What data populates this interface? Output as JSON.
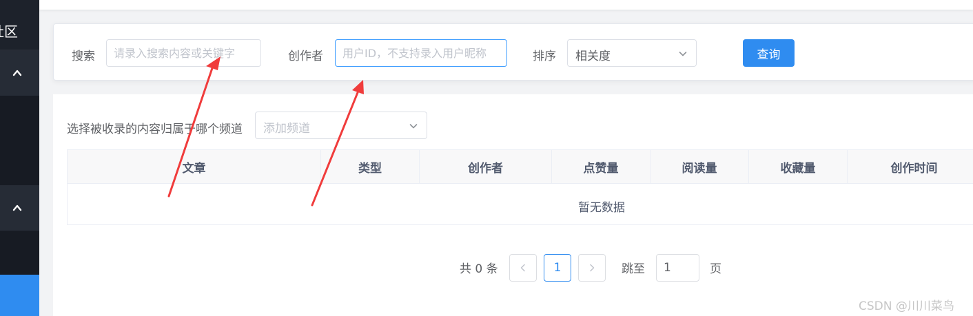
{
  "sidebar": {
    "brand_text": "社区",
    "groups": [
      {
        "icon": "chevron-up-icon"
      },
      {
        "icon": "chevron-up-icon"
      }
    ]
  },
  "search": {
    "keyword_label": "搜索",
    "keyword_placeholder": "请录入搜索内容或关键字",
    "author_label": "创作者",
    "author_placeholder": "用户ID，不支持录入用户昵称",
    "sort_label": "排序",
    "sort_value": "相关度",
    "query_button": "查询"
  },
  "channel": {
    "label": "选择被收录的内容归属于哪个频道",
    "placeholder": "添加频道"
  },
  "table": {
    "columns": [
      "文章",
      "类型",
      "创作者",
      "点赞量",
      "阅读量",
      "收藏量",
      "创作时间"
    ],
    "empty_text": "暂无数据"
  },
  "pagination": {
    "total_text": "共 0 条",
    "current_page": "1",
    "jump_label": "跳至",
    "jump_value": "1",
    "page_suffix": "页"
  },
  "watermark": "CSDN @川川菜鸟",
  "colors": {
    "primary": "#2f8cf0",
    "sidebar_bg": "#171b23",
    "annotation_arrow": "#f03c3c"
  }
}
